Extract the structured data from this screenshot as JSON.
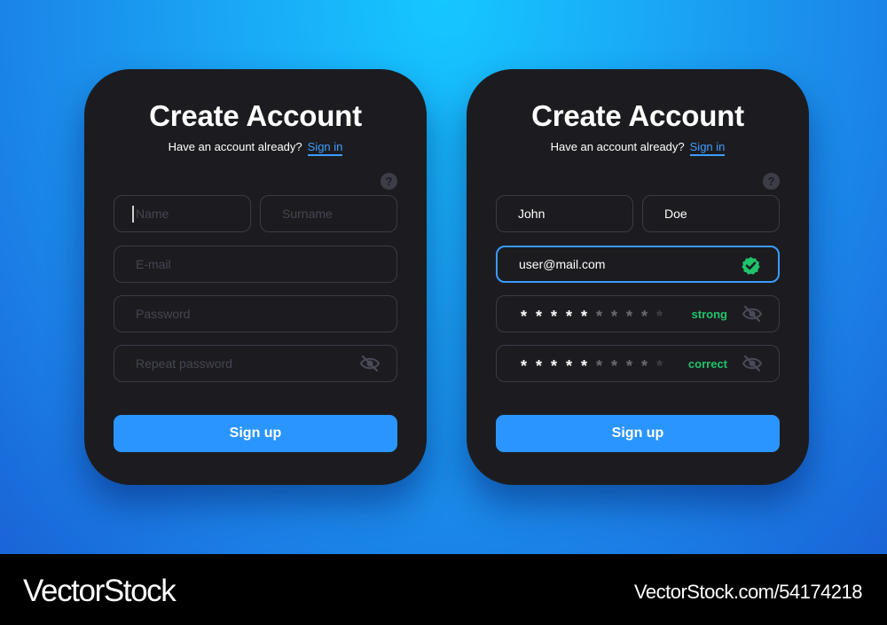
{
  "forms": [
    {
      "title": "Create Account",
      "subtitle": "Have an account already?",
      "signin_link": "Sign in",
      "help_icon": "?",
      "name_placeholder": "Name",
      "surname_placeholder": "Surname",
      "email_placeholder": "E-mail",
      "password_placeholder": "Password",
      "repeat_placeholder": "Repeat password",
      "signup_label": "Sign up"
    },
    {
      "title": "Create Account",
      "subtitle": "Have an account already?",
      "signin_link": "Sign in",
      "help_icon": "?",
      "name_value": "John",
      "surname_value": "Doe",
      "email_value": "user@mail.com",
      "password_strength": "strong",
      "repeat_status": "correct",
      "signup_label": "Sign up"
    }
  ],
  "icons": {
    "help": "question-icon",
    "visibility": "eye-slash-icon",
    "valid": "check-circle-icon"
  },
  "colors": {
    "accent": "#2b95ff",
    "card": "#1c1c20",
    "success": "#1fc36b",
    "field_border": "#3a3a46"
  },
  "footer": {
    "brand": "VectorStock",
    "reference": "VectorStock.com/54174218"
  }
}
